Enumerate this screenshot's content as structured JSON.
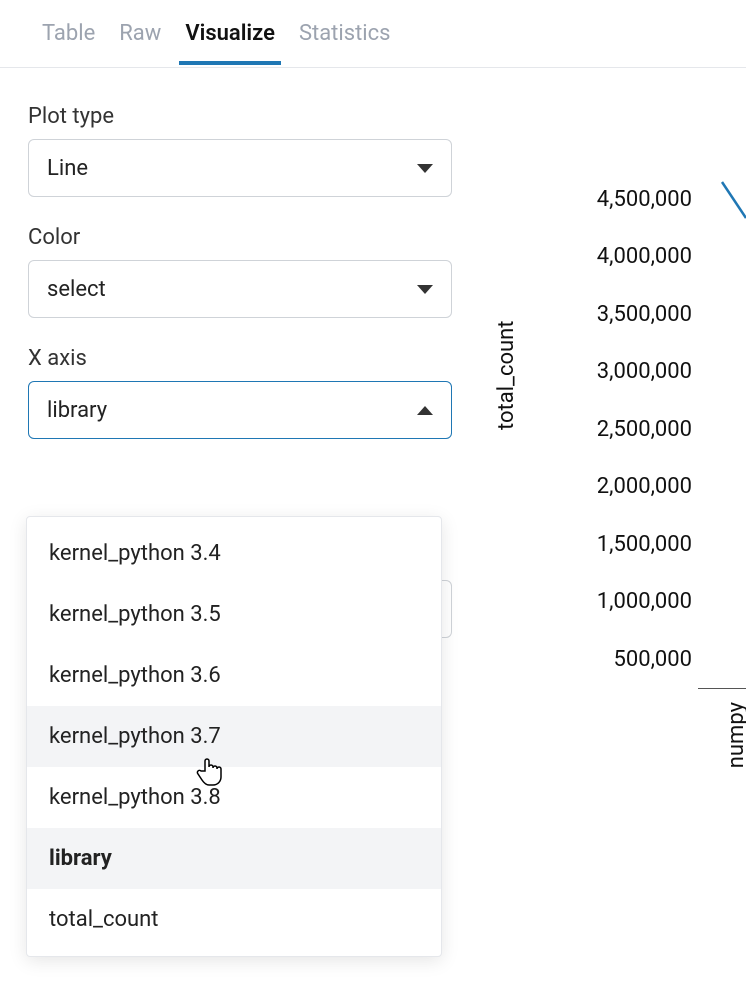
{
  "tabs": {
    "table": "Table",
    "raw": "Raw",
    "visualize": "Visualize",
    "statistics": "Statistics",
    "active": "visualize"
  },
  "controls": {
    "plot_type": {
      "label": "Plot type",
      "value": "Line"
    },
    "color": {
      "label": "Color",
      "value": "select"
    },
    "x_axis": {
      "label": "X axis",
      "value": "library",
      "open": true
    }
  },
  "x_axis_options": [
    {
      "label": "kernel_python 3.4",
      "state": ""
    },
    {
      "label": "kernel_python 3.5",
      "state": ""
    },
    {
      "label": "kernel_python 3.6",
      "state": ""
    },
    {
      "label": "kernel_python 3.7",
      "state": "hover"
    },
    {
      "label": "kernel_python 3.8",
      "state": ""
    },
    {
      "label": "library",
      "state": "selected"
    },
    {
      "label": "total_count",
      "state": ""
    }
  ],
  "chart_data": {
    "type": "line",
    "ylabel": "total_count",
    "yticks": [
      "4,500,000",
      "4,000,000",
      "3,500,000",
      "3,000,000",
      "2,500,000",
      "2,000,000",
      "1,500,000",
      "1,000,000",
      "500,000"
    ],
    "ylim": [
      500000,
      4500000
    ],
    "xtick0": "numpy",
    "series": [
      {
        "name": "total_count",
        "color": "#1f77b4"
      }
    ]
  }
}
